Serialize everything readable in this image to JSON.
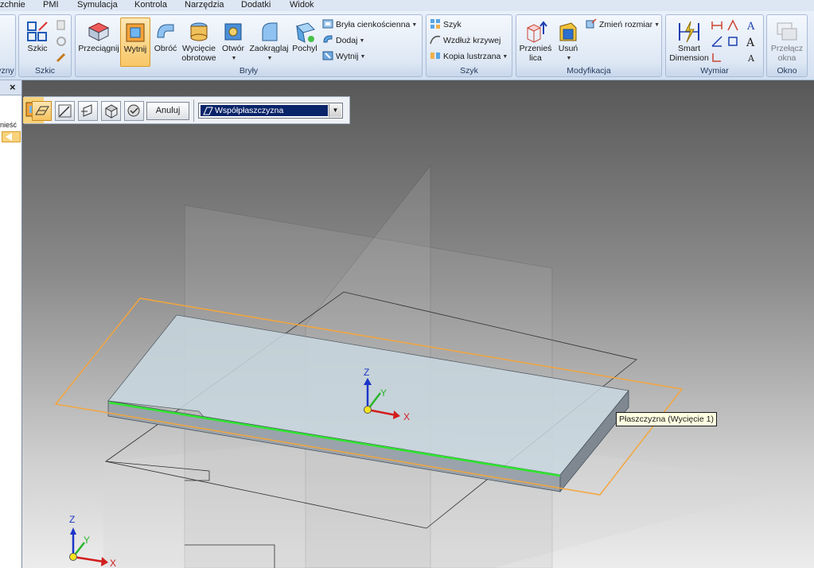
{
  "menu_tabs": [
    "zchnie",
    "PMI",
    "Symulacja",
    "Kontrola",
    "Narzędzia",
    "Dodatki",
    "Widok"
  ],
  "ribbon": {
    "groups": {
      "left_partial": "yzny",
      "szkic": "Szkic",
      "bryly": "Bryły",
      "szyk": "Szyk",
      "modyfikacja": "Modyfikacja",
      "wymiar": "Wymiar",
      "okno": "Okno"
    },
    "sketch_button": "Szkic",
    "solids": {
      "przeciagnij": "Przeciągnij",
      "wytnij": "Wytnij",
      "obroc": "Obróć",
      "wyciecie_obrotowe_1": "Wycięcie",
      "wyciecie_obrotowe_2": "obrotowe",
      "otwor": "Otwór",
      "zaokraglaj": "Zaokrąglaj",
      "pochyl": "Pochyl",
      "bryla_cienkoscienna": "Bryła cienkościenna",
      "dodaj": "Dodaj",
      "wytnij_small": "Wytnij"
    },
    "pattern": {
      "szyk": "Szyk",
      "wzdluz_krzywej": "Wzdłuż krzywej",
      "kopia_lustrzana": "Kopia lustrzana"
    },
    "modify": {
      "przenies_lica_1": "Przenieś",
      "przenies_lica_2": "lica",
      "usun": "Usuń",
      "zmien_rozmiar": "Zmień rozmiar"
    },
    "dimension": {
      "smart_1": "Smart",
      "smart_2": "Dimension"
    },
    "window": {
      "przelacz_1": "Przełącz",
      "przelacz_2": "okna"
    }
  },
  "left_pane": {
    "close_glyph": "×",
    "label": "nieść"
  },
  "command_bar": {
    "cancel_label": "Anuluj",
    "plane_value": "Współpłaszczyzna"
  },
  "viewport": {
    "tooltip": "Płaszczyzna (Wycięcie 1)",
    "axis_x": "X",
    "axis_y": "Y",
    "axis_z": "Z"
  },
  "colors": {
    "accent_orange": "#f4a53c",
    "edge_green": "#2ee62e",
    "axis_x": "#d21e1e",
    "axis_y": "#2ab52a",
    "axis_z": "#1c35c8",
    "origin_yellow": "#f5e31e"
  }
}
